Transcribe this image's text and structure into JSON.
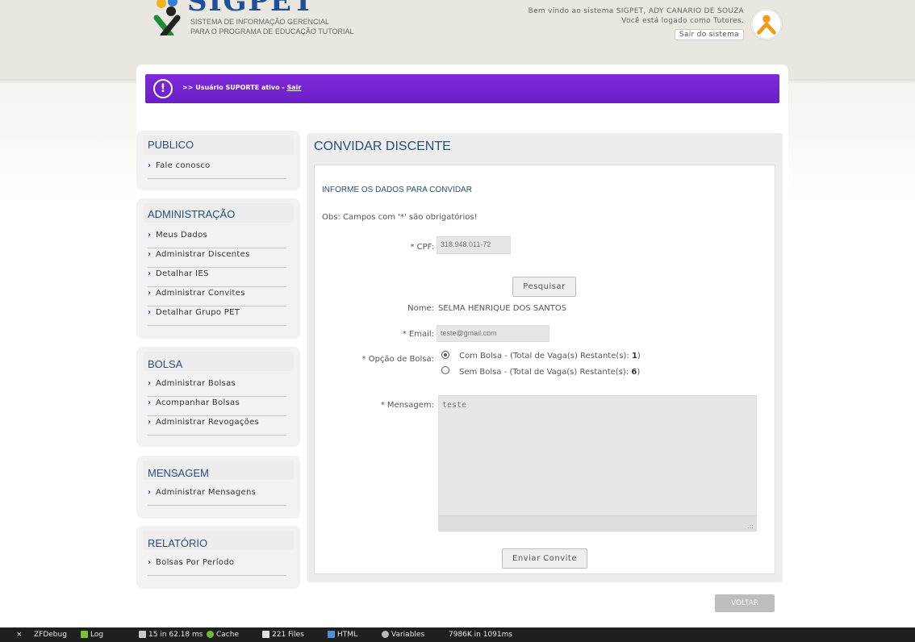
{
  "header": {
    "logo_text": "SIGPET",
    "logo_sub1": "SISTEMA DE INFORMAÇÃO GERENCIAL",
    "logo_sub2": "PARA O PROGRAMA DE EDUCAÇÃO TUTORIAL",
    "welcome_line1": "Bem vindo ao sistema SIGPET, ADY CANARIO DE SOUZA",
    "welcome_line2": "Você está logado como Tutores.",
    "logout_label": "Sair do sistema"
  },
  "alert": {
    "prefix": ">> Usuário SUPORTE ativo - ",
    "link": "Sair"
  },
  "sidebar": {
    "publico": {
      "title": "PUBLICO",
      "items": [
        "Fale conosco"
      ]
    },
    "administracao": {
      "title": "ADMINISTRAÇÃO",
      "items": [
        "Meus Dados",
        "Administrar Discentes",
        "Detalhar IES",
        "Administrar Convites",
        "Detalhar Grupo PET"
      ]
    },
    "bolsa": {
      "title": "BOLSA",
      "items": [
        "Administrar Bolsas",
        "Acompanhar Bolsas",
        "Administrar Revogações"
      ]
    },
    "mensagem": {
      "title": "MENSAGEM",
      "items": [
        "Administrar Mensagens"
      ]
    },
    "relatorio": {
      "title": "RELATÓRIO",
      "items": [
        "Bolsas Por Período"
      ]
    }
  },
  "content": {
    "title": "CONVIDAR DISCENTE",
    "section_title": "INFORME OS DADOS PARA CONVIDAR",
    "obs": "Obs: Campos com '*' são obrigatórios!",
    "cpf_label": "* CPF:",
    "cpf_value": "318.948.011-72",
    "search_button": "Pesquisar",
    "nome_label": "Nome:",
    "nome_value": "SELMA HENRIQUE DOS SANTOS",
    "email_label": "* Email:",
    "email_value": "teste@gmail.com",
    "bolsa_label": "* Opção de Bolsa:",
    "option_com_text": "Com Bolsa - (Total de Vaga(s) Restante(s): ",
    "option_com_count": "1",
    "option_sem_text": "Sem Bolsa - (Total de Vaga(s) Restante(s): ",
    "option_sem_count": "6",
    "option_close": ")",
    "mensagem_label": "* Mensagem:",
    "mensagem_value": "teste",
    "send_button": "Enviar Convite",
    "back_button": "VOLTAR"
  },
  "debug": {
    "close": "×",
    "zfdebug": "ZFDebug",
    "log": "Log",
    "db": "15 in 62.18 ms",
    "cache": "Cache",
    "files": "221 Files",
    "html": "HTML",
    "variables": "Variables",
    "memory": "7986K in 1091ms"
  }
}
